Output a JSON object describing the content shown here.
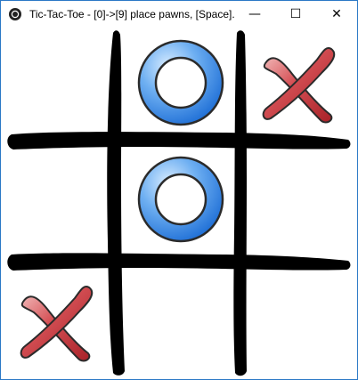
{
  "window": {
    "title": "Tic-Tac-Toe - [0]->[9] place pawns, [Space]...",
    "controls": {
      "minimize": "—",
      "maximize": "☐",
      "close": "✕"
    }
  },
  "board": {
    "cells": [
      [
        "",
        "O",
        "X"
      ],
      [
        "",
        "O",
        ""
      ],
      [
        "X",
        "",
        ""
      ]
    ],
    "colors": {
      "grid": "#000000",
      "o_fill": "#3a87e6",
      "x_fill": "#c63a3f"
    }
  }
}
